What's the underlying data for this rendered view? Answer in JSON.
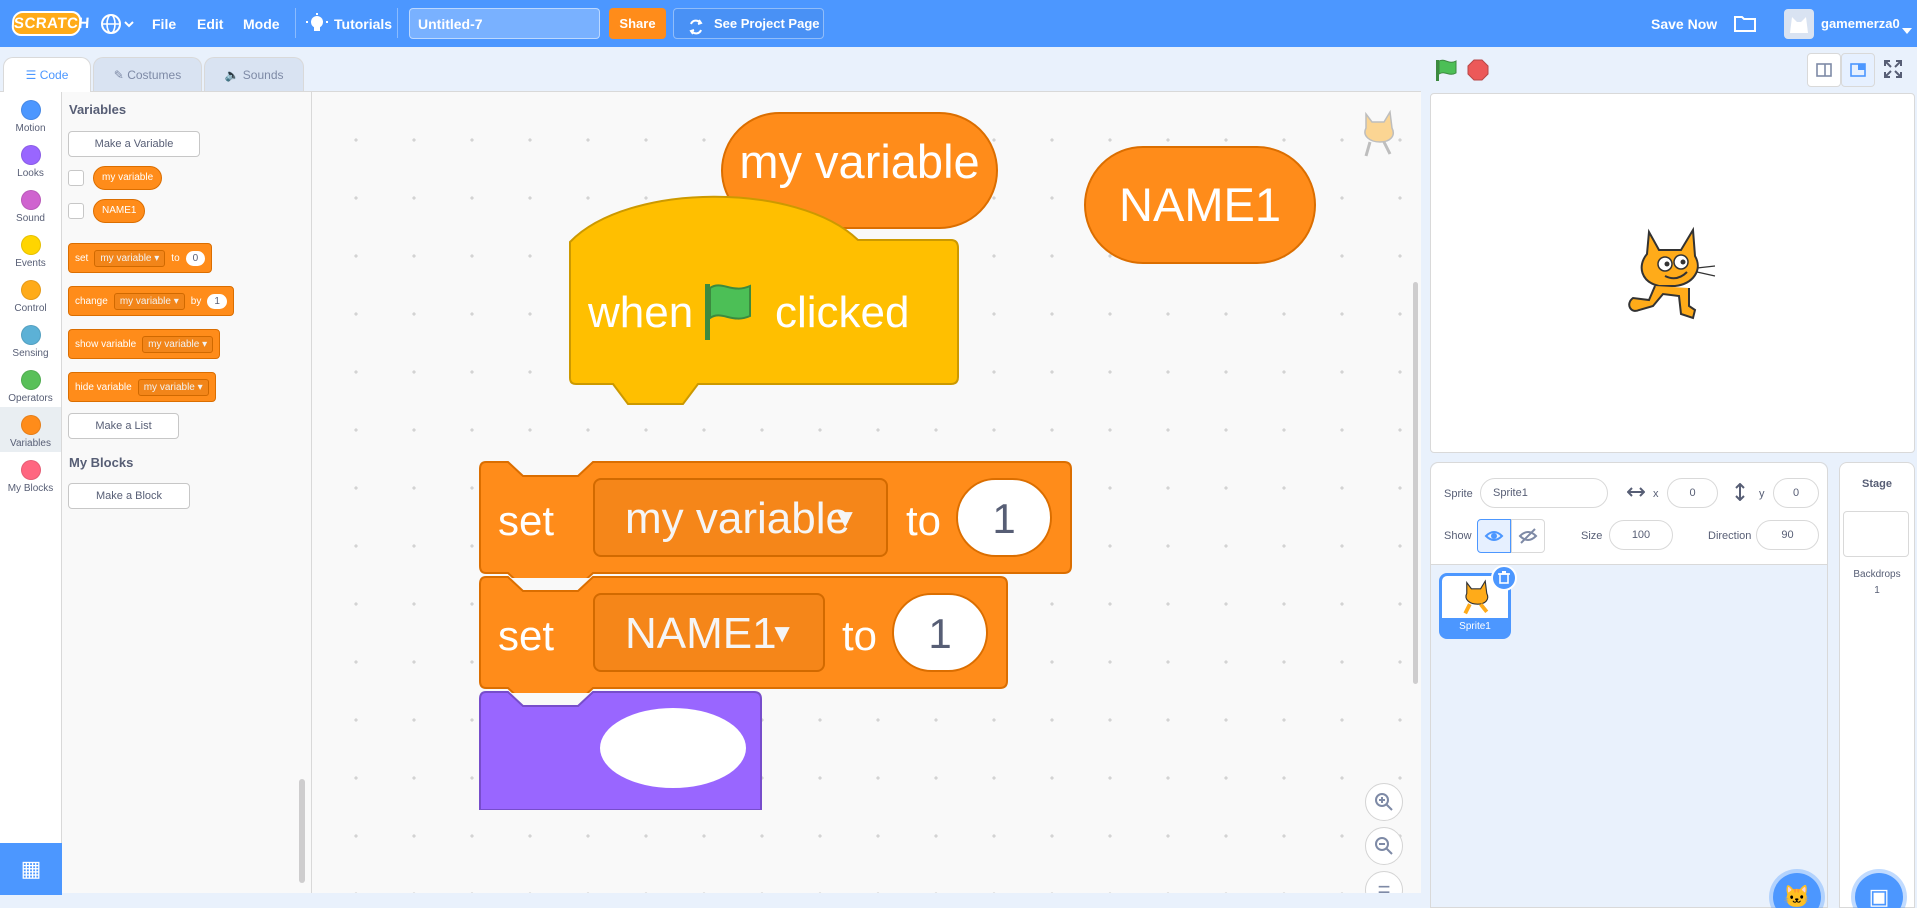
{
  "menu": {
    "logo": "SCRATCH",
    "file": "File",
    "edit": "Edit",
    "mode": "Mode",
    "tutorials": "Tutorials",
    "project_title": "Untitled-7",
    "share": "Share",
    "see_project_page": "See Project Page",
    "save_now": "Save Now",
    "username": "gamemerza0"
  },
  "tabs": {
    "code": "Code",
    "costumes": "Costumes",
    "sounds": "Sounds"
  },
  "categories": [
    {
      "label": "Motion",
      "color": "#4c97ff"
    },
    {
      "label": "Looks",
      "color": "#9966ff"
    },
    {
      "label": "Sound",
      "color": "#cf63cf"
    },
    {
      "label": "Events",
      "color": "#ffd500"
    },
    {
      "label": "Control",
      "color": "#ffab19"
    },
    {
      "label": "Sensing",
      "color": "#5cb1d6"
    },
    {
      "label": "Operators",
      "color": "#59c059"
    },
    {
      "label": "Variables",
      "color": "#ff8c1a"
    },
    {
      "label": "My Blocks",
      "color": "#ff6680"
    }
  ],
  "flyout": {
    "variables_heading": "Variables",
    "make_variable": "Make a Variable",
    "vars": [
      "my variable",
      "NAME1"
    ],
    "set_block": {
      "verb": "set",
      "var": "my variable",
      "prep": "to",
      "value": "0"
    },
    "change_block": {
      "verb": "change",
      "var": "my variable",
      "prep": "by",
      "value": "1"
    },
    "show_block": {
      "verb": "show variable",
      "var": "my variable"
    },
    "hide_block": {
      "verb": "hide variable",
      "var": "my variable"
    },
    "make_list": "Make a List",
    "myblocks_heading": "My Blocks",
    "make_block": "Make a Block"
  },
  "workspace": {
    "reporter_my_variable": "my variable",
    "reporter_name1": "NAME1",
    "hat": {
      "left": "when",
      "right": "clicked"
    },
    "set1": {
      "verb": "set",
      "var": "my variable",
      "prep": "to",
      "value": "1"
    },
    "set2": {
      "verb": "set",
      "var": "NAME1",
      "prep": "to",
      "value": "1"
    },
    "zoom_in": "+",
    "zoom_out": "−",
    "zoom_reset": "="
  },
  "sprite_info": {
    "sprite_label": "Sprite",
    "sprite_name": "Sprite1",
    "x_label": "x",
    "x_value": "0",
    "y_label": "y",
    "y_value": "0",
    "show_label": "Show",
    "size_label": "Size",
    "size_value": "100",
    "direction_label": "Direction",
    "direction_value": "90"
  },
  "sprites": [
    {
      "name": "Sprite1"
    }
  ],
  "stage_pane": {
    "title": "Stage",
    "backdrops_label": "Backdrops",
    "backdrops_count": "1"
  },
  "colors": {
    "accent": "#4c97ff",
    "variables": "#ff8c1a",
    "events": "#ffbf00",
    "share": "#ff8c1a"
  }
}
